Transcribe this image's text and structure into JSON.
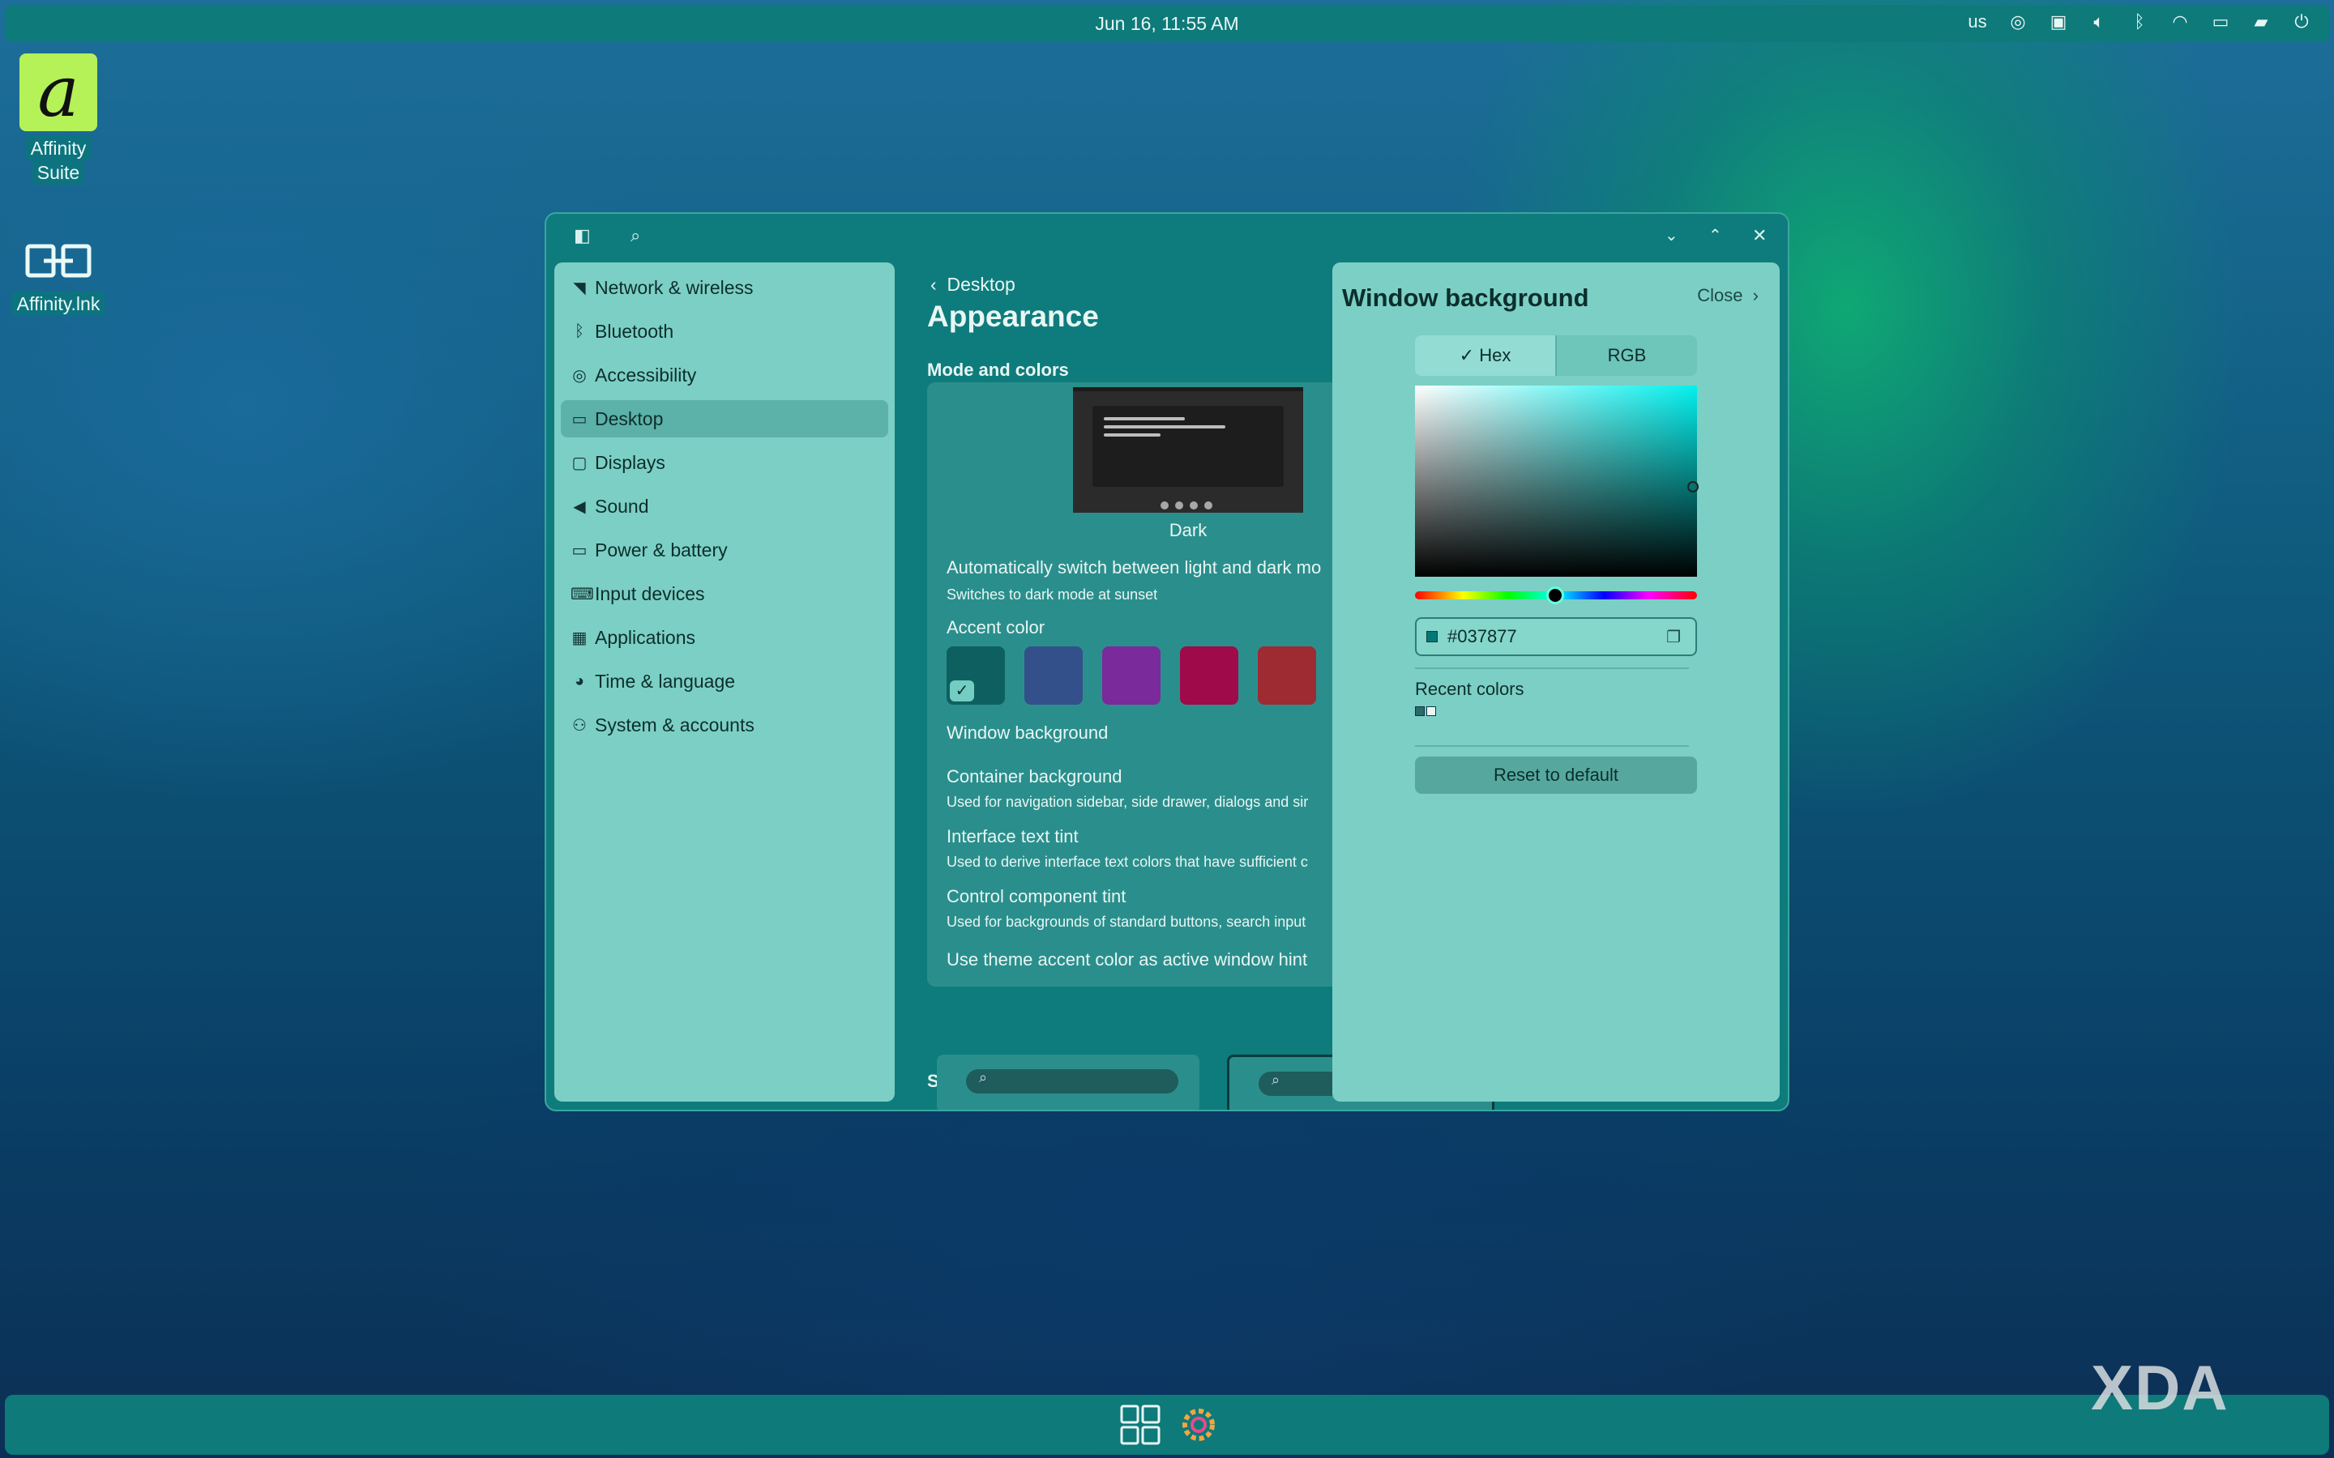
{
  "topbar": {
    "datetime": "Jun 16, 11:55 AM",
    "keyboard_layout": "us"
  },
  "desktop_icons": [
    {
      "label_line1": "Affinity",
      "label_line2": "Suite",
      "glyph": "a"
    },
    {
      "label": "Affinity.lnk"
    }
  ],
  "window": {
    "sidebar": {
      "items": [
        {
          "label": "Network & wireless",
          "icon": "wifi-icon"
        },
        {
          "label": "Bluetooth",
          "icon": "bluetooth-icon"
        },
        {
          "label": "Accessibility",
          "icon": "accessibility-icon"
        },
        {
          "label": "Desktop",
          "icon": "desktop-icon",
          "active": true
        },
        {
          "label": "Displays",
          "icon": "display-icon"
        },
        {
          "label": "Sound",
          "icon": "speaker-icon"
        },
        {
          "label": "Power & battery",
          "icon": "battery-icon"
        },
        {
          "label": "Input devices",
          "icon": "keyboard-icon"
        },
        {
          "label": "Applications",
          "icon": "apps-icon"
        },
        {
          "label": "Time & language",
          "icon": "time-icon"
        },
        {
          "label": "System & accounts",
          "icon": "users-icon"
        }
      ]
    },
    "main": {
      "breadcrumb": "Desktop",
      "title": "Appearance",
      "section_mode": "Mode and colors",
      "mode_label": "Dark",
      "auto_switch_title": "Automatically switch between light and dark mo",
      "auto_switch_sub": "Switches to dark mode at sunset",
      "accent_label": "Accent color",
      "accent_colors": [
        "#0e6060",
        "#34508a",
        "#7a2a9a",
        "#9e0a4a",
        "#9e2a32"
      ],
      "window_bg_label": "Window background",
      "container_bg_title": "Container background",
      "container_bg_sub": "Used for navigation sidebar, side drawer, dialogs and sir",
      "text_tint_title": "Interface text tint",
      "text_tint_sub": "Used to derive interface text colors that have sufficient c",
      "control_tint_title": "Control component tint",
      "control_tint_sub": "Used for backgrounds of standard buttons, search input",
      "accent_hint": "Use theme accent color as active window hint",
      "section_style": "Style"
    },
    "drawer": {
      "title": "Window background",
      "close_label": "Close",
      "tab_hex": "Hex",
      "tab_rgb": "RGB",
      "hex_value": "#037877",
      "recent_label": "Recent colors",
      "recent_colors": [
        "#2a6a68",
        "#eaf6f4"
      ],
      "reset_label": "Reset to default"
    }
  },
  "watermark": "XDA"
}
